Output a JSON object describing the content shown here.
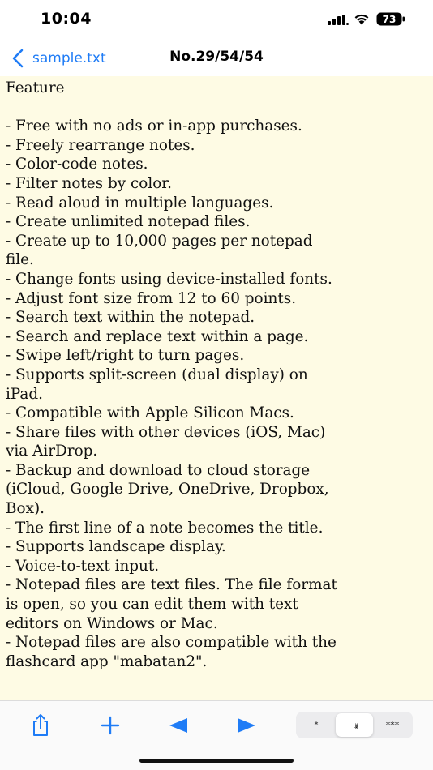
{
  "status": {
    "time": "10:04",
    "battery": "73"
  },
  "nav": {
    "back_label": "sample.txt",
    "title": "No.29/54/54"
  },
  "editor": {
    "lines": [
      "Feature",
      "",
      "- Free with no ads or in-app purchases.",
      "- Freely rearrange notes.",
      "- Color-code notes.",
      "- Filter notes by color.",
      "- Read aloud in multiple languages.",
      "- Create unlimited notepad files.",
      "- Create up to 10,000 pages per notepad",
      "file.",
      "- Change fonts using device-installed fonts.",
      "- Adjust font size from 12 to 60 points.",
      "- Search text within the notepad.",
      "- Search and replace text within a page.",
      "- Swipe left/right to turn pages.",
      "- Supports split-screen (dual display) on",
      "iPad.",
      "- Compatible with Apple Silicon Macs.",
      "- Share files with other devices (iOS, Mac)",
      "via AirDrop.",
      "- Backup and download to cloud storage",
      "(iCloud, Google Drive, OneDrive, Dropbox,",
      "Box).",
      "- The first line of a note becomes the title.",
      "- Supports landscape display.",
      "- Voice-to-text input.",
      "- Notepad files are text files. The file format",
      "is open, so you can edit them with text",
      "editors on Windows or Mac.",
      "- Notepad files are also compatible with the",
      "flashcard app \"mabatan2\"."
    ]
  },
  "toolbar": {
    "segments": [
      {
        "label": "*",
        "selected": false
      },
      {
        "label": "**",
        "selected": true
      },
      {
        "label": "***",
        "selected": false
      }
    ]
  },
  "colors": {
    "accent": "#1f7cf6",
    "editor_background": "#fefbe4"
  },
  "icons": {
    "back": "chevron-left-icon",
    "share": "share-icon",
    "add": "plus-icon",
    "prev": "triangle-left-icon",
    "next": "triangle-right-icon"
  }
}
